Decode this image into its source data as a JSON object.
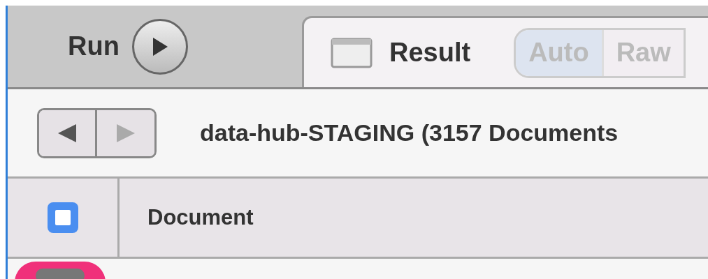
{
  "toolbar": {
    "run_label": "Run"
  },
  "tab": {
    "label": "Result",
    "selected": true
  },
  "view_modes": [
    {
      "label": "Auto",
      "selected": true,
      "disabled": true
    },
    {
      "label": "Raw",
      "selected": false,
      "disabled": true
    }
  ],
  "navigation": {
    "back_disabled": false,
    "forward_disabled": true
  },
  "collection_title": "data-hub-STAGING (3157 Documents",
  "table": {
    "select_all_checked": false,
    "columns": [
      "Document"
    ]
  }
}
